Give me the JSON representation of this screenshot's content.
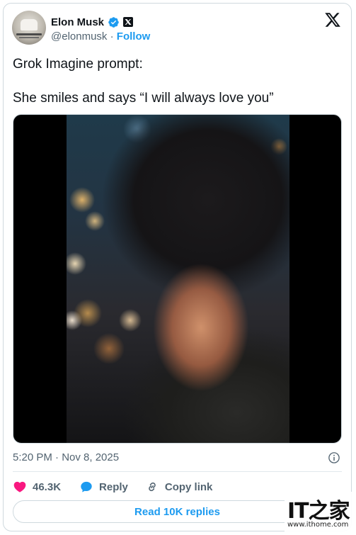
{
  "author": {
    "name": "Elon Musk",
    "handle": "@elonmusk",
    "separator": " · ",
    "follow_label": "Follow"
  },
  "tweet": {
    "line1": "Grok Imagine prompt:",
    "line2": "She smiles and says “I will always love you”",
    "timestamp": "5:20 PM · Nov 8, 2025"
  },
  "actions": {
    "like_count": "46.3K",
    "reply_label": "Reply",
    "copy_link_label": "Copy link"
  },
  "read_replies_label": "Read 10K replies",
  "watermark": {
    "logo": "IT之家",
    "url": "www.ithome.com"
  },
  "colors": {
    "accent": "#1d9bf0",
    "like": "#f91880",
    "text_secondary": "#536471",
    "verified": "#1d9bf0"
  }
}
